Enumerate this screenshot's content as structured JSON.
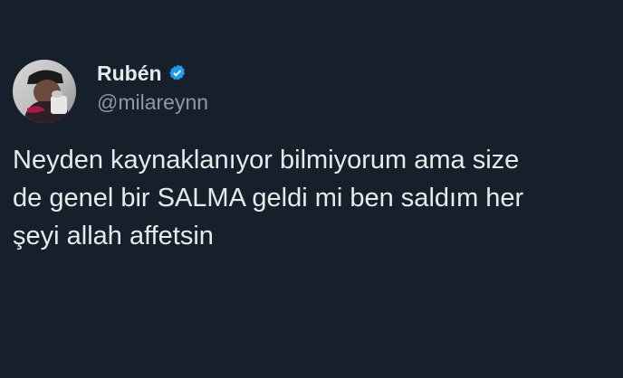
{
  "author": {
    "display_name": "Rubén",
    "handle": "@milareynn",
    "verified_icon": "verified-badge-icon",
    "avatar_icon": "profile-avatar"
  },
  "tweet": {
    "text": "Neyden kaynaklanıyor bilmiyorum ama size\nde genel bir SALMA geldi mi ben saldım her\nşeyi allah affetsin"
  },
  "colors": {
    "background": "#15202b",
    "primary_text": "#e7e9ea",
    "secondary_text": "#8b98a5",
    "verified_blue": "#1d9bf0"
  }
}
